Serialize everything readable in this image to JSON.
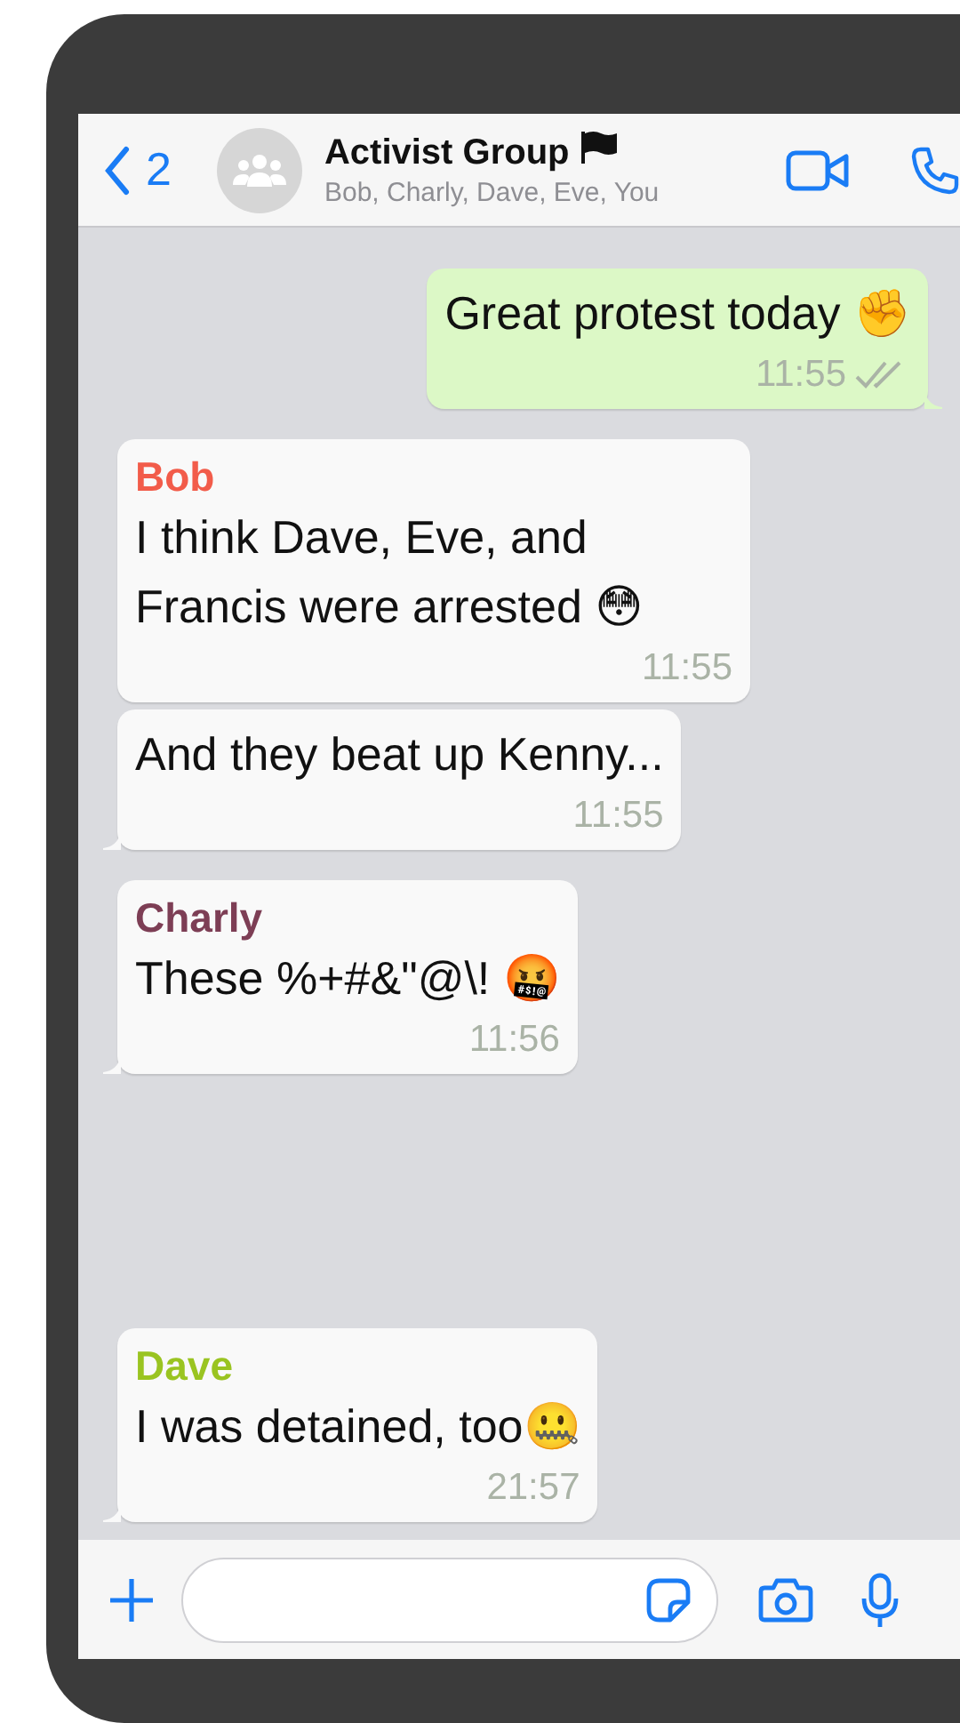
{
  "header": {
    "back_count": "2",
    "title": "Activist Group",
    "title_flag": true,
    "subtitle": "Bob, Charly, Dave, Eve, You"
  },
  "messages": [
    {
      "kind": "outgoing",
      "text": "Great protest today ✊",
      "time": "11:55",
      "tail": true
    },
    {
      "kind": "incoming",
      "sender": "Bob",
      "color": "#f25c4a",
      "text": "I think Dave, Eve, and Francis were arrested 😳",
      "time": "11:55",
      "tail": false
    },
    {
      "kind": "incoming",
      "text": "And they beat up Kenny...",
      "time": "11:55",
      "tail": true
    },
    {
      "kind": "incoming",
      "sender": "Charly",
      "color": "#7d3e55",
      "text": "These %+#&\"@\\! 🤬",
      "time": "11:56",
      "tail": true
    },
    {
      "kind": "incoming",
      "sender": "Dave",
      "color": "#9ac421",
      "text": "I was detained, too🤐",
      "time": "21:57",
      "tail": true
    }
  ]
}
